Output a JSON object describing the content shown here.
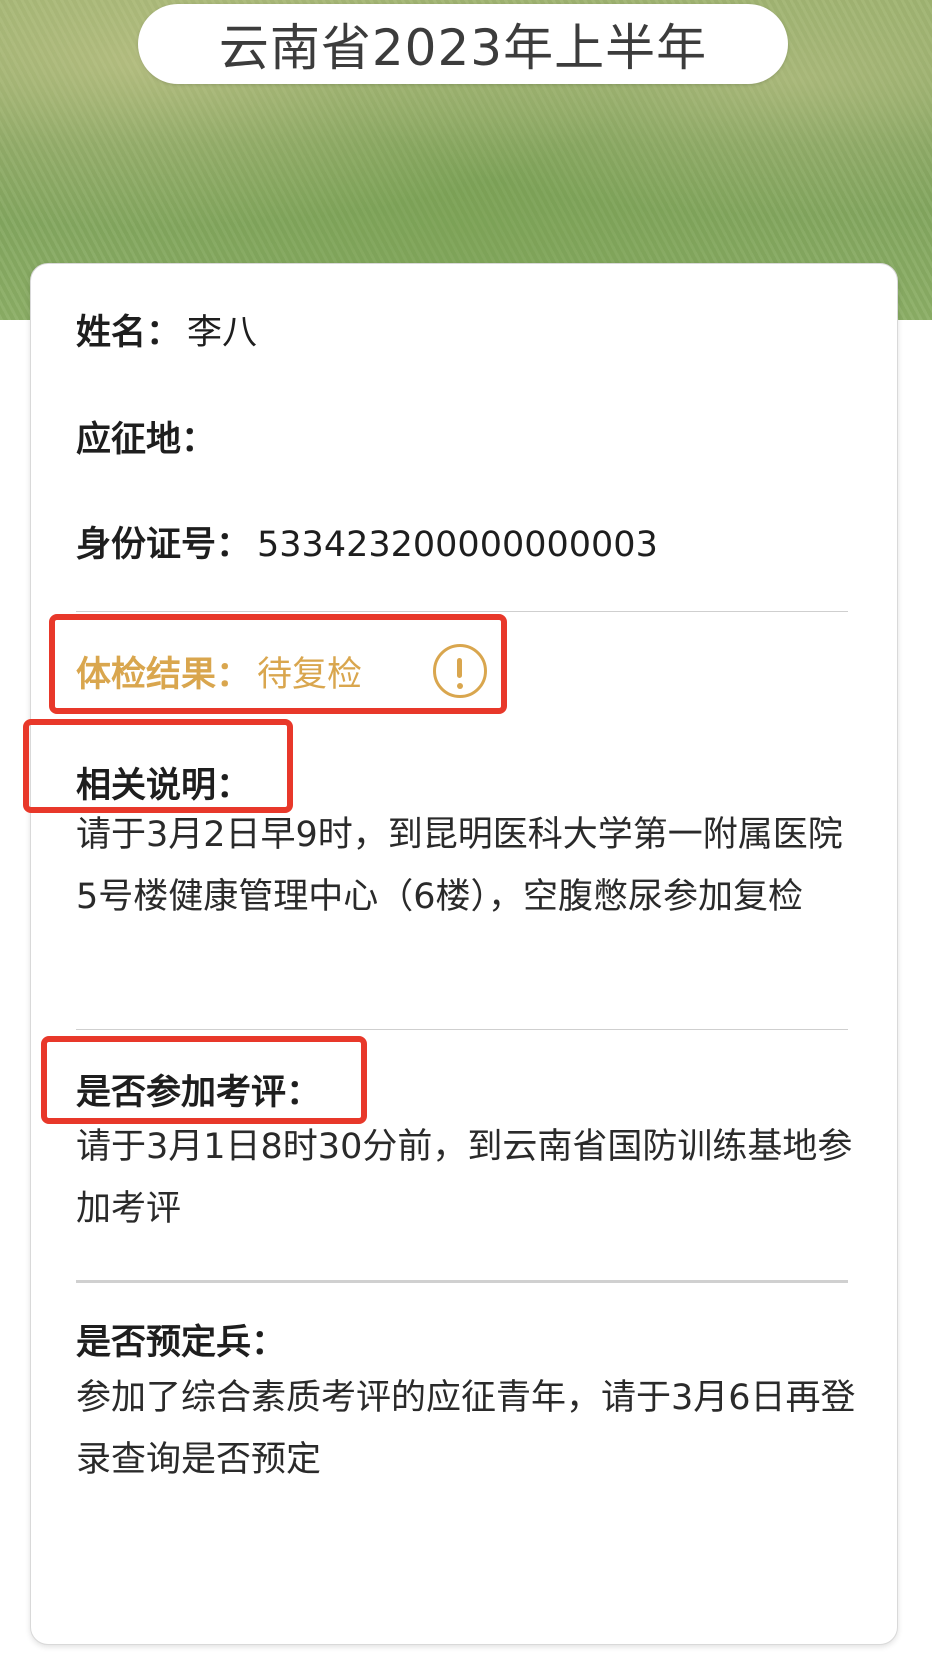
{
  "header": {
    "title": "云南省2023年上半年"
  },
  "card": {
    "name": {
      "label": "姓名：",
      "value": "李八"
    },
    "region": {
      "label": "应征地：",
      "value": ""
    },
    "id_number": {
      "label": "身份证号：",
      "value": "533423200000000003"
    },
    "exam_result": {
      "label": "体检结果：",
      "value": "待复检",
      "icon": "exclamation-circle-icon",
      "color": "#d9a64e"
    },
    "notes": {
      "label": "相关说明：",
      "text": "请于3月2日早9时，到昆明医科大学第一附属医院5号楼健康管理中心（6楼），空腹憋尿参加复检"
    },
    "evaluation": {
      "label": "是否参加考评：",
      "text": "请于3月1日8时30分前，到云南省国防训练基地参加考评"
    },
    "reserved": {
      "label": "是否预定兵：",
      "text": "参加了综合素质考评的应征青年，请于3月6日再登录查询是否预定"
    }
  },
  "colors": {
    "highlight": "#e8382a",
    "warning": "#d9a64e",
    "header_green": "#7ea25b"
  }
}
